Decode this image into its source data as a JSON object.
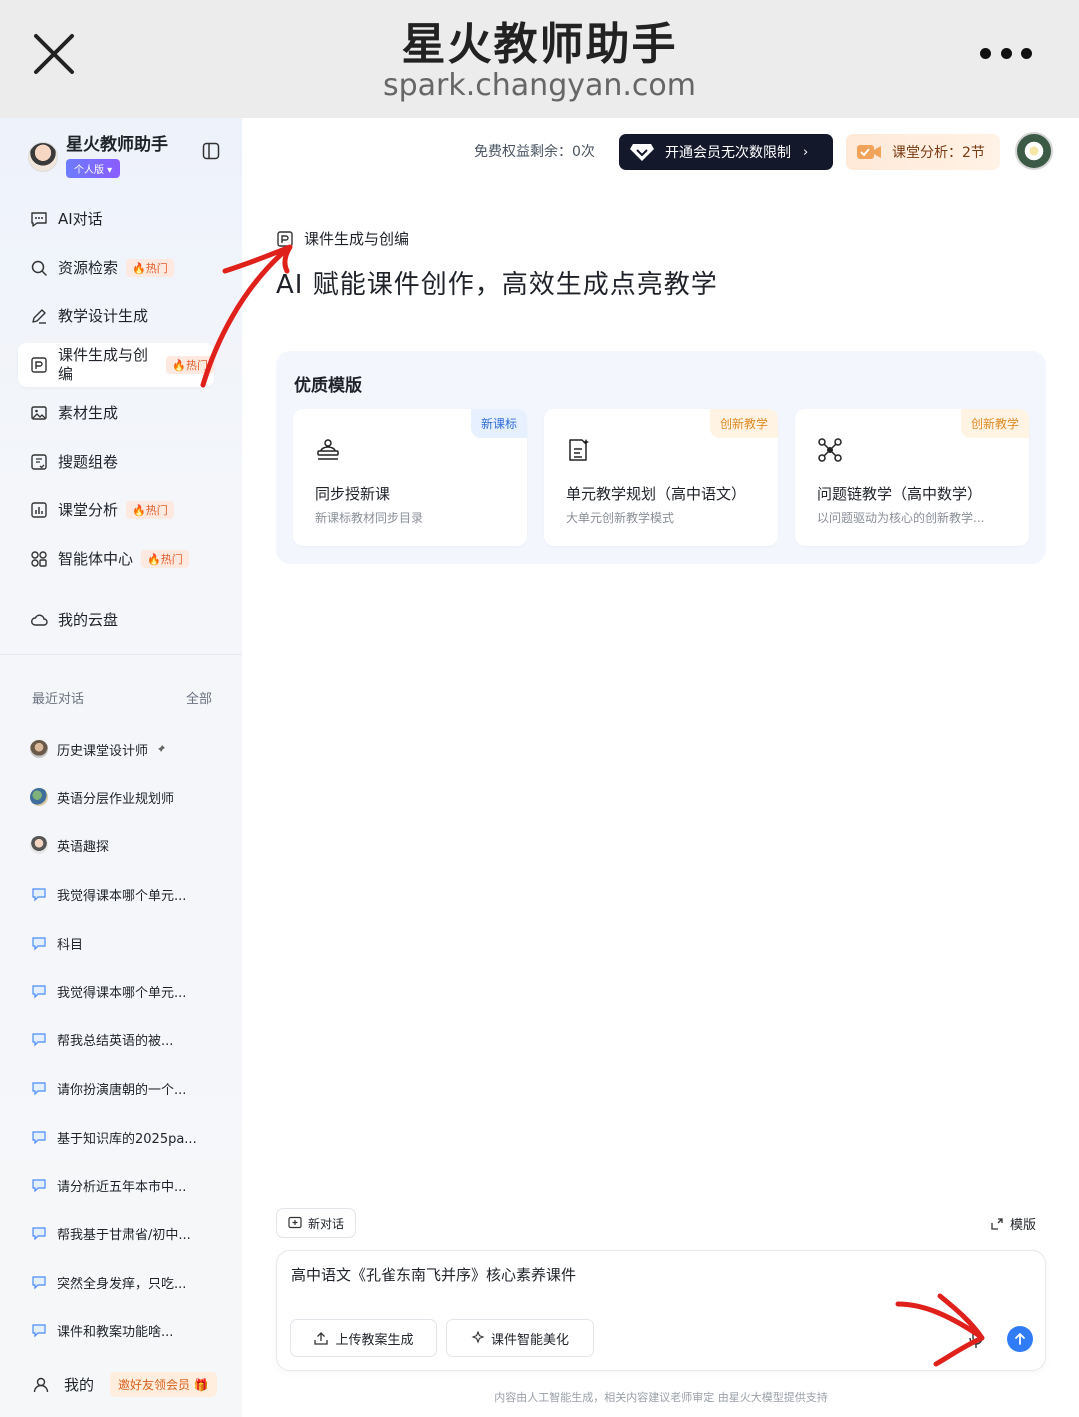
{
  "browser": {
    "title": "星火教师助手",
    "url": "spark.changyan.com"
  },
  "sidebar": {
    "brand": "星火教师助手",
    "edition_badge": "个人版",
    "hot_label": "热门",
    "items": [
      {
        "label": "AI对话",
        "icon": "chat-bubble-icon",
        "hot": false
      },
      {
        "label": "资源检索",
        "icon": "search-icon",
        "hot": true
      },
      {
        "label": "教学设计生成",
        "icon": "pencil-icon",
        "hot": false
      },
      {
        "label": "课件生成与创编",
        "icon": "courseware-icon",
        "hot": true,
        "hot_text": "热门"
      },
      {
        "label": "素材生成",
        "icon": "image-icon",
        "hot": false
      },
      {
        "label": "搜题组卷",
        "icon": "quiz-icon",
        "hot": false
      },
      {
        "label": "课堂分析",
        "icon": "chart-icon",
        "hot": true
      },
      {
        "label": "智能体中心",
        "icon": "agents-icon",
        "hot": true
      },
      {
        "label": "我的云盘",
        "icon": "cloud-icon",
        "hot": false
      }
    ],
    "recent_title": "最近对话",
    "recent_all": "全部",
    "recent": [
      "历史课堂设计师",
      "英语分层作业规划师",
      "英语趣探",
      "我觉得课本哪个单元...",
      "科目",
      "我觉得课本哪个单元...",
      "帮我总结英语的被...",
      "请你扮演唐朝的一个...",
      "基于知识库的2025pa...",
      "请分析近五年本市中...",
      "帮我基于甘肃省/初中...",
      "突然全身发痒，只吃...",
      "课件和教案功能啥..."
    ],
    "me_label": "我的",
    "invite_label": "邀好友领会员"
  },
  "header": {
    "quota_text": "免费权益剩余：0次",
    "vip_button": "开通会员无次数限制",
    "class_analysis": "课堂分析：2节"
  },
  "page": {
    "tag": "课件生成与创编",
    "title": "AI 赋能课件创作，高效生成点亮教学"
  },
  "templates": {
    "heading": "优质模版",
    "cards": [
      {
        "tag": "新课标",
        "title": "同步授新课",
        "subtitle": "新课标教材同步目录",
        "icon": "teacher-desk-icon"
      },
      {
        "tag": "创新教学",
        "title": "单元教学规划（高中语文）",
        "subtitle": "大单元创新教学模式",
        "icon": "document-sparkle-icon"
      },
      {
        "tag": "创新教学",
        "title": "问题链教学（高中数学）",
        "subtitle": "以问题驱动为核心的创新教学...",
        "icon": "network-icon"
      }
    ]
  },
  "composer": {
    "new_chat": "新对话",
    "template_link": "模版",
    "input_value": "高中语文《孔雀东南飞并序》核心素养课件",
    "upload_button": "上传教案生成",
    "beautify_button": "课件智能美化",
    "disclaimer": "内容由人工智能生成，相关内容建议老师审定 由星火大模型提供支持"
  },
  "colors": {
    "accent_blue": "#2f7cf6",
    "vip_dark": "#14182b",
    "hot_orange": "#e25c2b",
    "annotation_red": "#e0201b"
  }
}
